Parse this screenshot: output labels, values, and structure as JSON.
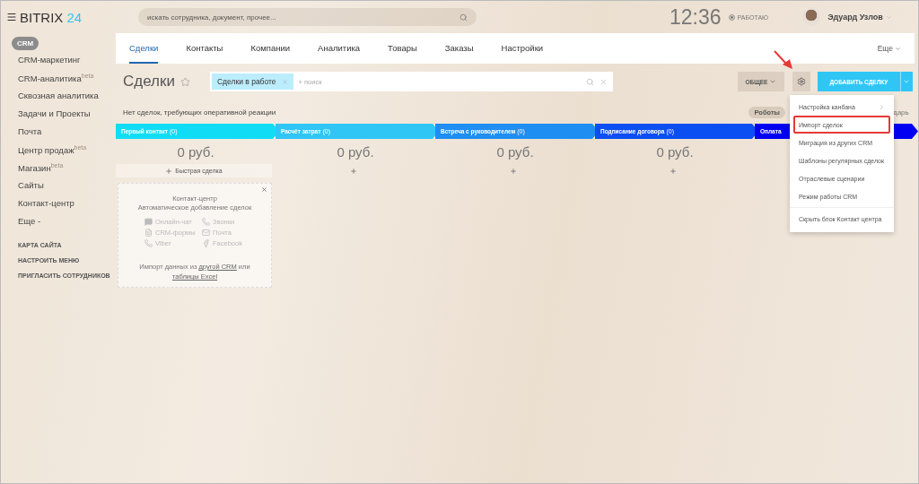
{
  "header": {
    "logo_word": "BITRIX",
    "logo_number": "24",
    "search": {
      "placeholder": "искать сотрудника, документ, прочее..."
    },
    "clock": "12:36",
    "status": "РАБОТАЮ",
    "user": "Эдуард Узлов"
  },
  "sidebar": {
    "section": "CRM",
    "items": [
      {
        "label": "CRM-маркетинг"
      },
      {
        "label": "CRM-аналитика$^{beta}$"
      },
      {
        "label": "Сквозная аналитика"
      },
      {
        "label": "Задачи и Проекты"
      },
      {
        "label": "Почта"
      },
      {
        "label": "Центр продаж$^{beta}$"
      },
      {
        "label": "Магазин$^{beta}$"
      },
      {
        "label": "Сайты"
      },
      {
        "label": "Контакт-центр"
      },
      {
        "label": "Еще -"
      }
    ],
    "links": [
      "КАРТА САЙТА",
      "НАСТРОИТЬ МЕНЮ",
      "ПРИГЛАСИТЬ СОТРУДНИКОВ"
    ]
  },
  "tabs": [
    {
      "label": "Сделки",
      "selected": true
    },
    {
      "label": "Контакты",
      "selected": false
    },
    {
      "label": "Компании",
      "selected": false
    },
    {
      "label": "Аналитика",
      "selected": false
    },
    {
      "label": "Товары",
      "selected": false
    },
    {
      "label": "Заказы",
      "selected": false
    },
    {
      "label": "Настройки",
      "selected": false
    }
  ],
  "tabs_more": "Еще",
  "toolbar": {
    "title": "Сделки",
    "filter_tag": "Сделки в работе",
    "filter_placeholder": "+ поиск",
    "category_button": "ОБЩЕЕ",
    "add_button": "ДОБАВИТЬ СДЕЛКУ"
  },
  "notice": "Нет сделок, требующих оперативной реакции",
  "robots_button": "Роботы",
  "calendar_tail": "дарь",
  "stages": [
    {
      "name": "Первый контакт",
      "count": "(0)",
      "color": "#11dcf6",
      "amount": "0 руб.",
      "add": "Быстрая сделка"
    },
    {
      "name": "Расчёт затрат",
      "count": "(0)",
      "color": "#2fc6f6",
      "amount": "0 руб."
    },
    {
      "name": "Встреча с руководителем",
      "count": "(0)",
      "color": "#1e8ef2",
      "amount": "0 руб."
    },
    {
      "name": "Подписание договора",
      "count": "(0)",
      "color": "#0b4ff2",
      "amount": "0 руб."
    },
    {
      "name": "Оплата",
      "color": "#0000f2"
    }
  ],
  "contact_center": {
    "title": "Контакт-центр",
    "subtitle": "Автоматическое добавление сделок",
    "channels": [
      {
        "kind": "chat",
        "label": "Онлайн-чат"
      },
      {
        "kind": "phone",
        "label": "Звонки"
      },
      {
        "kind": "form",
        "label": "CRM-формы"
      },
      {
        "kind": "mail",
        "label": "Почта"
      },
      {
        "kind": "viber",
        "label": "Viber"
      },
      {
        "kind": "facebook",
        "label": "Facebook"
      }
    ],
    "import_prefix": "Импорт данных из",
    "import_link_1": "другой CRM",
    "import_middle": "или",
    "import_link_2": "таблицы Excel"
  },
  "settings_menu": [
    {
      "label": "Настройка канбана",
      "submenu": true,
      "highlighted": false
    },
    {
      "label": "Импорт сделок",
      "submenu": false,
      "highlighted": true
    },
    {
      "label": "Миграция из других CRM",
      "submenu": false,
      "highlighted": false
    },
    {
      "label": "Шаблоны регулярных сделок",
      "submenu": false,
      "highlighted": false
    },
    {
      "label": "Отраслевые сценарии",
      "submenu": false,
      "highlighted": false
    },
    {
      "label": "Режим работы CRM",
      "submenu": false,
      "highlighted": false
    },
    {
      "label": "Скрыть блок Контакт центра",
      "submenu": false,
      "highlighted": false
    }
  ]
}
